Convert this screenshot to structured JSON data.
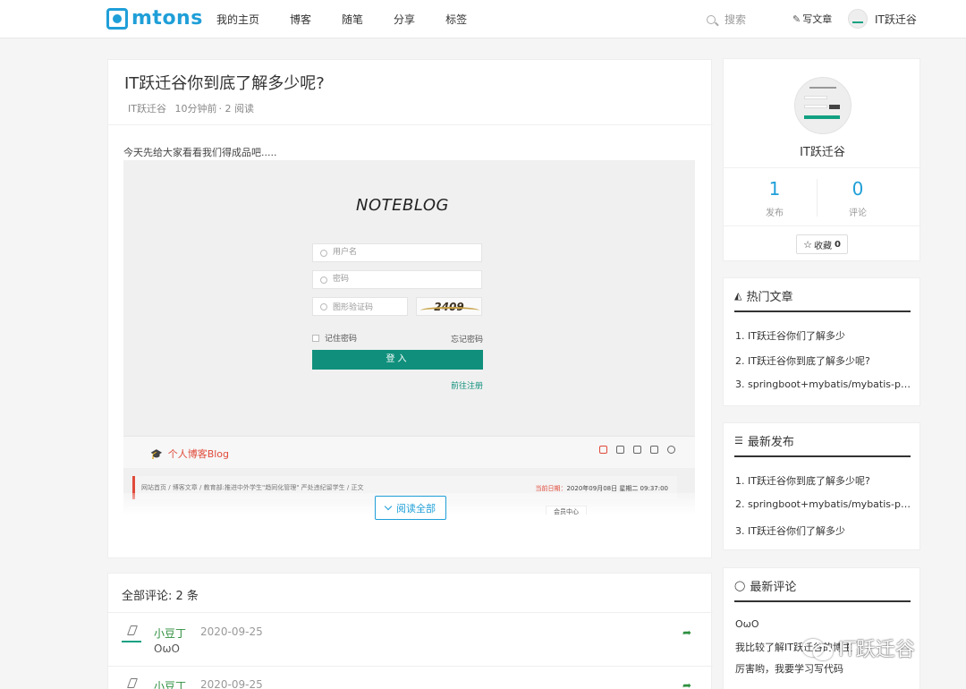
{
  "nav": {
    "logo": "mtons",
    "links": [
      "我的主页",
      "博客",
      "随笔",
      "分享",
      "标签"
    ],
    "search_placeholder": "搜索",
    "write_label": "写文章",
    "username": "IT跃迁谷"
  },
  "post": {
    "title": "IT跃迁谷你到底了解多少呢?",
    "author": "IT跃迁谷",
    "time": "10分钟前",
    "reads": "· 2 阅读",
    "intro": "今天先给大家看看我们得成品吧.....",
    "read_all": "阅读全部",
    "screenshot": {
      "brand": "NOTEBLOG",
      "username_placeholder": "用户名",
      "password_placeholder": "密码",
      "captcha_placeholder": "图形验证码",
      "captcha_code": "2409",
      "remember": "记住密码",
      "forget": "忘记密码",
      "login": "登入",
      "register": "前往注册",
      "blog_name": "个人博客Blog",
      "breadcrumb": "网站首页  /  博客文章  /  教育部:推进中外学生\"趋同化管理\" 严处违纪留学生  /  正文",
      "date_label": "当前日期：",
      "date_value": "2020年09月08日 星期二 09:37:00",
      "member": "会员中心"
    }
  },
  "comments": {
    "title": "全部评论: 2 条",
    "items": [
      {
        "name": "小豆丁",
        "date": "2020-09-25",
        "text": "OωO"
      },
      {
        "name": "小豆丁",
        "date": "2020-09-25",
        "text": ""
      }
    ]
  },
  "profile": {
    "name": "IT跃迁谷",
    "posts_count": "1",
    "posts_label": "发布",
    "comments_count": "0",
    "comments_label": "评论",
    "fav_label": "收藏",
    "fav_count": "0"
  },
  "hot": {
    "title": "热门文章",
    "items": [
      "1. IT跃迁谷你们了解多少",
      "2. IT跃迁谷你到底了解多少呢?",
      "3. springboot+mybatis/mybatis-plus"
    ]
  },
  "latest": {
    "title": "最新发布",
    "items": [
      "1. IT跃迁谷你到底了解多少呢?",
      "2. springboot+mybatis/mybatis-plus",
      "3. IT跃迁谷你们了解多少"
    ]
  },
  "recent_comments": {
    "title": "最新评论",
    "items": [
      "OωO",
      "我比较了解IT跃迁谷的博主",
      "厉害哟，我要学习写代码"
    ]
  },
  "watermark": "IT跃迁谷",
  "colors": {
    "accent": "#1f9fd8",
    "green": "#10907c",
    "red": "#e04a3a"
  }
}
